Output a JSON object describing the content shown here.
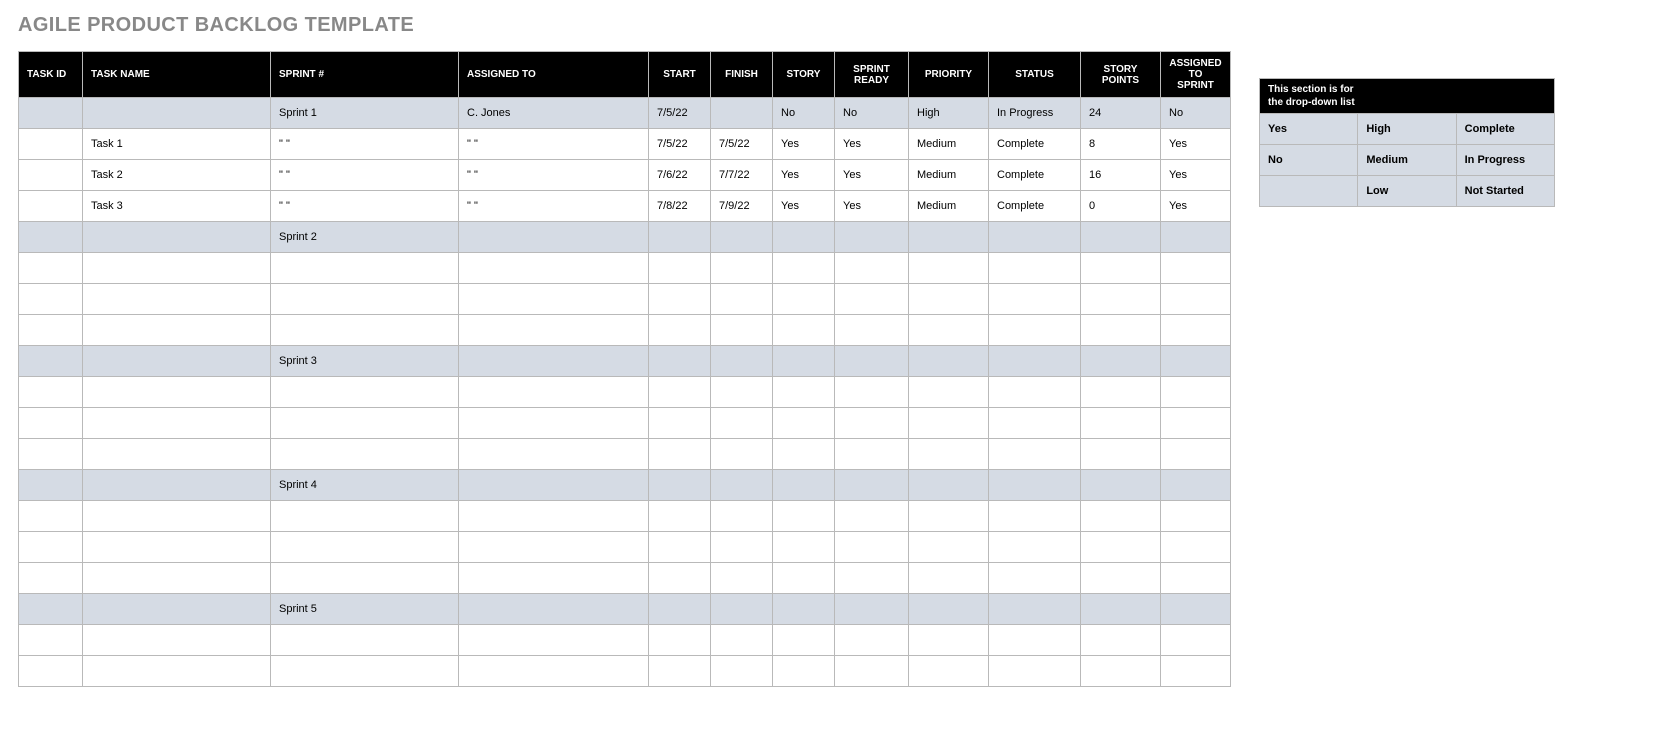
{
  "title": "AGILE PRODUCT BACKLOG TEMPLATE",
  "columns": {
    "task_id": "TASK ID",
    "task_name": "TASK NAME",
    "sprint_no": "SPRINT #",
    "assigned_to": "ASSIGNED TO",
    "start": "START",
    "finish": "FINISH",
    "story": "STORY",
    "sprint_ready": "SPRINT READY",
    "priority": "PRIORITY",
    "status": "STATUS",
    "story_points": "STORY POINTS",
    "assigned_to_sprint": "ASSIGNED TO SPRINT"
  },
  "rows": [
    {
      "type": "sprint",
      "task_id": "",
      "task_name": "",
      "sprint_no": "Sprint 1",
      "assigned_to": "C. Jones",
      "start": "7/5/22",
      "finish": "",
      "story": "No",
      "sprint_ready": "No",
      "priority": "High",
      "status": "In Progress",
      "story_points": "24",
      "assigned_to_sprint": "No"
    },
    {
      "type": "task",
      "task_id": "",
      "task_name": "Task 1",
      "sprint_no": "\" \"",
      "assigned_to": "\" \"",
      "start": "7/5/22",
      "finish": "7/5/22",
      "story": "Yes",
      "sprint_ready": "Yes",
      "priority": "Medium",
      "status": "Complete",
      "story_points": "8",
      "assigned_to_sprint": "Yes"
    },
    {
      "type": "task",
      "task_id": "",
      "task_name": "Task 2",
      "sprint_no": "\" \"",
      "assigned_to": "\" \"",
      "start": "7/6/22",
      "finish": "7/7/22",
      "story": "Yes",
      "sprint_ready": "Yes",
      "priority": "Medium",
      "status": "Complete",
      "story_points": "16",
      "assigned_to_sprint": "Yes"
    },
    {
      "type": "task",
      "task_id": "",
      "task_name": "Task 3",
      "sprint_no": "\" \"",
      "assigned_to": "\" \"",
      "start": "7/8/22",
      "finish": "7/9/22",
      "story": "Yes",
      "sprint_ready": "Yes",
      "priority": "Medium",
      "status": "Complete",
      "story_points": "0",
      "assigned_to_sprint": "Yes"
    },
    {
      "type": "sprint",
      "task_id": "",
      "task_name": "",
      "sprint_no": "Sprint 2",
      "assigned_to": "",
      "start": "",
      "finish": "",
      "story": "",
      "sprint_ready": "",
      "priority": "",
      "status": "",
      "story_points": "",
      "assigned_to_sprint": ""
    },
    {
      "type": "task",
      "task_id": "",
      "task_name": "",
      "sprint_no": "",
      "assigned_to": "",
      "start": "",
      "finish": "",
      "story": "",
      "sprint_ready": "",
      "priority": "",
      "status": "",
      "story_points": "",
      "assigned_to_sprint": ""
    },
    {
      "type": "task",
      "task_id": "",
      "task_name": "",
      "sprint_no": "",
      "assigned_to": "",
      "start": "",
      "finish": "",
      "story": "",
      "sprint_ready": "",
      "priority": "",
      "status": "",
      "story_points": "",
      "assigned_to_sprint": ""
    },
    {
      "type": "task",
      "task_id": "",
      "task_name": "",
      "sprint_no": "",
      "assigned_to": "",
      "start": "",
      "finish": "",
      "story": "",
      "sprint_ready": "",
      "priority": "",
      "status": "",
      "story_points": "",
      "assigned_to_sprint": ""
    },
    {
      "type": "sprint",
      "task_id": "",
      "task_name": "",
      "sprint_no": "Sprint 3",
      "assigned_to": "",
      "start": "",
      "finish": "",
      "story": "",
      "sprint_ready": "",
      "priority": "",
      "status": "",
      "story_points": "",
      "assigned_to_sprint": ""
    },
    {
      "type": "task",
      "task_id": "",
      "task_name": "",
      "sprint_no": "",
      "assigned_to": "",
      "start": "",
      "finish": "",
      "story": "",
      "sprint_ready": "",
      "priority": "",
      "status": "",
      "story_points": "",
      "assigned_to_sprint": ""
    },
    {
      "type": "task",
      "task_id": "",
      "task_name": "",
      "sprint_no": "",
      "assigned_to": "",
      "start": "",
      "finish": "",
      "story": "",
      "sprint_ready": "",
      "priority": "",
      "status": "",
      "story_points": "",
      "assigned_to_sprint": ""
    },
    {
      "type": "task",
      "task_id": "",
      "task_name": "",
      "sprint_no": "",
      "assigned_to": "",
      "start": "",
      "finish": "",
      "story": "",
      "sprint_ready": "",
      "priority": "",
      "status": "",
      "story_points": "",
      "assigned_to_sprint": ""
    },
    {
      "type": "sprint",
      "task_id": "",
      "task_name": "",
      "sprint_no": "Sprint 4",
      "assigned_to": "",
      "start": "",
      "finish": "",
      "story": "",
      "sprint_ready": "",
      "priority": "",
      "status": "",
      "story_points": "",
      "assigned_to_sprint": ""
    },
    {
      "type": "task",
      "task_id": "",
      "task_name": "",
      "sprint_no": "",
      "assigned_to": "",
      "start": "",
      "finish": "",
      "story": "",
      "sprint_ready": "",
      "priority": "",
      "status": "",
      "story_points": "",
      "assigned_to_sprint": ""
    },
    {
      "type": "task",
      "task_id": "",
      "task_name": "",
      "sprint_no": "",
      "assigned_to": "",
      "start": "",
      "finish": "",
      "story": "",
      "sprint_ready": "",
      "priority": "",
      "status": "",
      "story_points": "",
      "assigned_to_sprint": ""
    },
    {
      "type": "task",
      "task_id": "",
      "task_name": "",
      "sprint_no": "",
      "assigned_to": "",
      "start": "",
      "finish": "",
      "story": "",
      "sprint_ready": "",
      "priority": "",
      "status": "",
      "story_points": "",
      "assigned_to_sprint": ""
    },
    {
      "type": "sprint",
      "task_id": "",
      "task_name": "",
      "sprint_no": "Sprint 5",
      "assigned_to": "",
      "start": "",
      "finish": "",
      "story": "",
      "sprint_ready": "",
      "priority": "",
      "status": "",
      "story_points": "",
      "assigned_to_sprint": ""
    },
    {
      "type": "task",
      "task_id": "",
      "task_name": "",
      "sprint_no": "",
      "assigned_to": "",
      "start": "",
      "finish": "",
      "story": "",
      "sprint_ready": "",
      "priority": "",
      "status": "",
      "story_points": "",
      "assigned_to_sprint": ""
    },
    {
      "type": "task",
      "task_id": "",
      "task_name": "",
      "sprint_no": "",
      "assigned_to": "",
      "start": "",
      "finish": "",
      "story": "",
      "sprint_ready": "",
      "priority": "",
      "status": "",
      "story_points": "",
      "assigned_to_sprint": ""
    }
  ],
  "dropdowns": {
    "header_line1": "This section is for",
    "header_line2": "the drop-down list",
    "rows": [
      {
        "yesno": "Yes",
        "priority": "High",
        "status": "Complete"
      },
      {
        "yesno": "No",
        "priority": "Medium",
        "status": "In Progress"
      },
      {
        "yesno": "",
        "priority": "Low",
        "status": "Not Started"
      }
    ]
  },
  "fields": [
    "task_id",
    "task_name",
    "sprint_no",
    "assigned_to",
    "start",
    "finish",
    "story",
    "sprint_ready",
    "priority",
    "status",
    "story_points",
    "assigned_to_sprint"
  ]
}
